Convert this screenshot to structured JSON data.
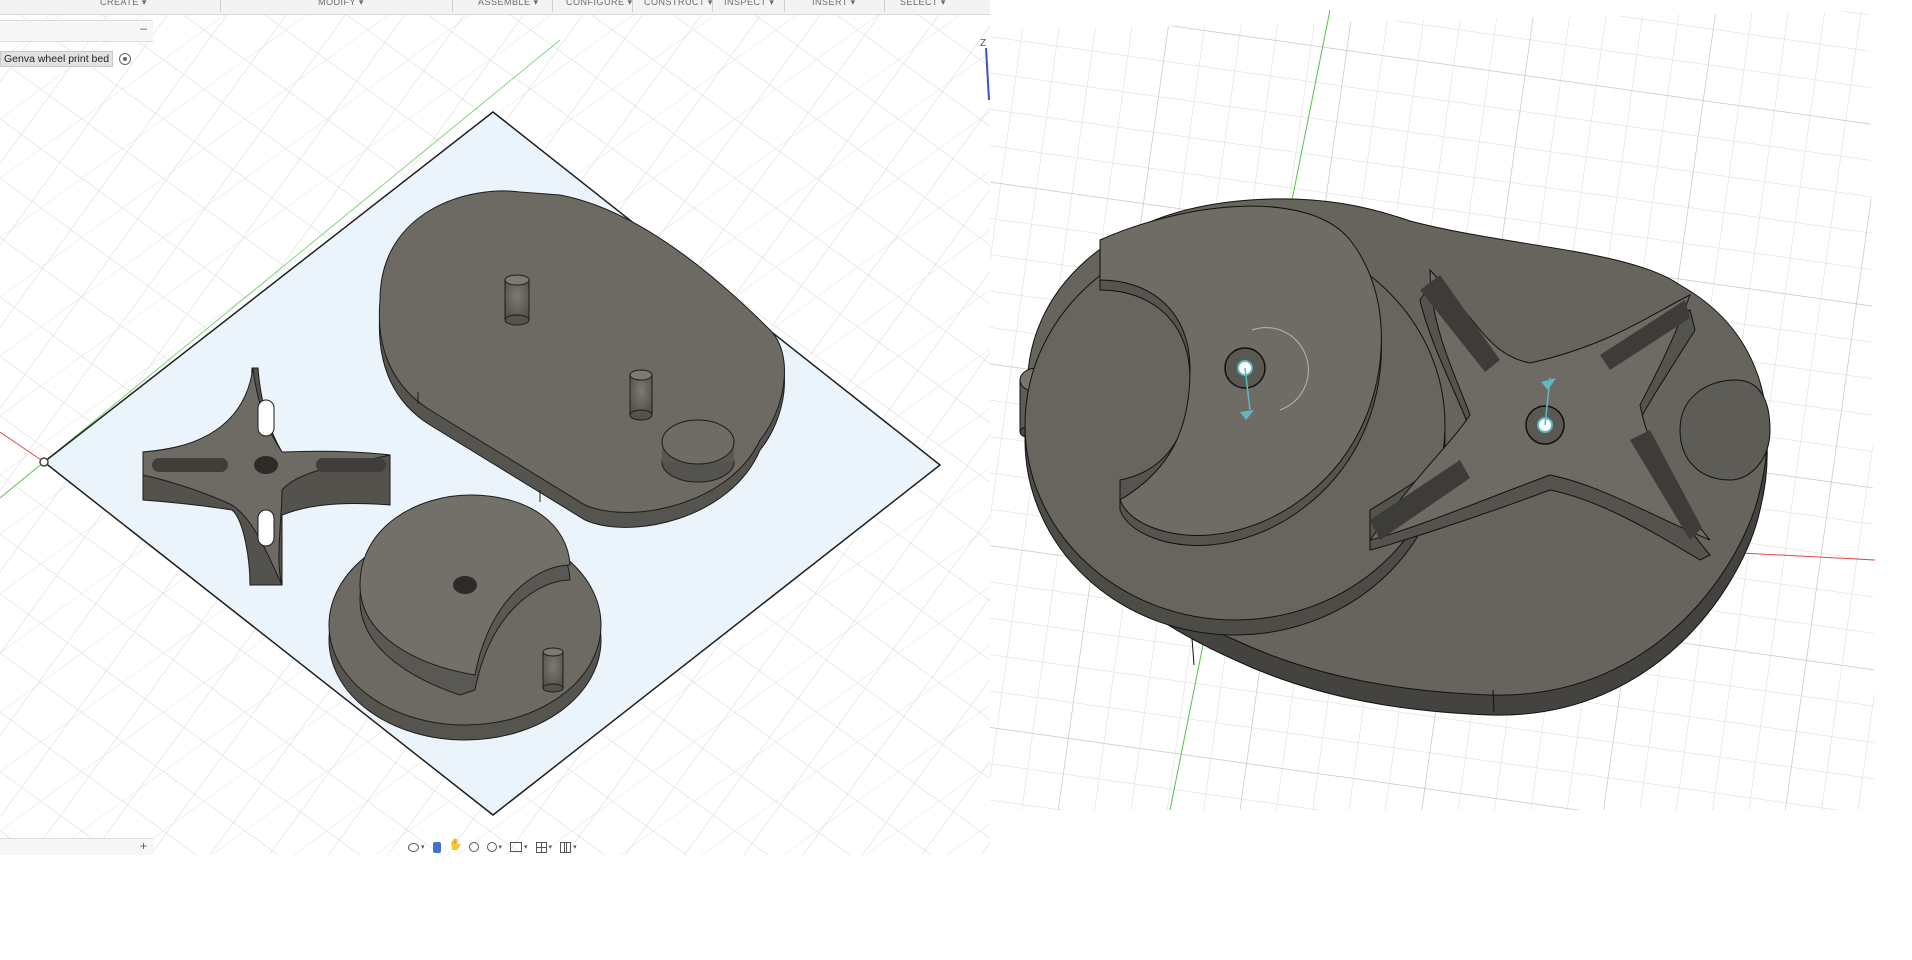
{
  "toolbar": {
    "menus": [
      "CREATE ▾",
      "MODIFY ▾",
      "ASSEMBLE ▾",
      "CONFIGURE ▾",
      "CONSTRUCT ▾",
      "INSPECT ▾",
      "INSERT ▾",
      "SELECT ▾"
    ]
  },
  "browser": {
    "collapse_label": "–",
    "component_name": "Genva wheel print bed"
  },
  "comments": {
    "add_label": "+"
  },
  "viewcube": {
    "axis_label": "Z"
  },
  "navigation_bar": {
    "icons": [
      "orbit-icon",
      "look-at-icon",
      "pan-icon",
      "zoom-icon",
      "fit-icon",
      "display-settings-icon",
      "grid-settings-icon",
      "viewports-icon"
    ]
  },
  "colors": {
    "part_body": "#6b6962",
    "part_dark": "#4a4944",
    "part_top": "#737069",
    "bed_fill": "#eef6fb",
    "grid_line": "#d4d4d4",
    "x_axis": "#e04848",
    "y_axis": "#52c352",
    "joint_cyan": "#5fb8c2"
  }
}
